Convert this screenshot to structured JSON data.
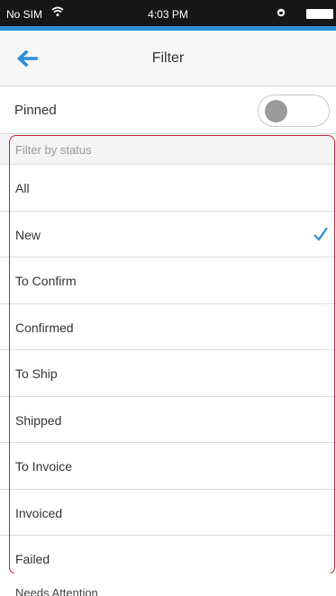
{
  "status_bar": {
    "carrier": "No SIM",
    "time": "4:03 PM",
    "wifi_icon": "wifi-icon",
    "battery_icon": "battery-icon"
  },
  "nav": {
    "back_icon": "back-arrow-icon",
    "title": "Filter",
    "accent_color": "#2b8ed8"
  },
  "pinned": {
    "label": "Pinned",
    "enabled": false
  },
  "filter": {
    "header": "Filter by status",
    "items": [
      {
        "label": "All",
        "selected": false
      },
      {
        "label": "New",
        "selected": true
      },
      {
        "label": "To Confirm",
        "selected": false
      },
      {
        "label": "Confirmed",
        "selected": false
      },
      {
        "label": "To Ship",
        "selected": false
      },
      {
        "label": "Shipped",
        "selected": false
      },
      {
        "label": "To Invoice",
        "selected": false
      },
      {
        "label": "Invoiced",
        "selected": false
      },
      {
        "label": "Failed",
        "selected": false
      }
    ],
    "highlight_color": "#c0263a",
    "check_color": "#2b8ed8"
  },
  "next_section": {
    "header": "Needs Attention"
  }
}
